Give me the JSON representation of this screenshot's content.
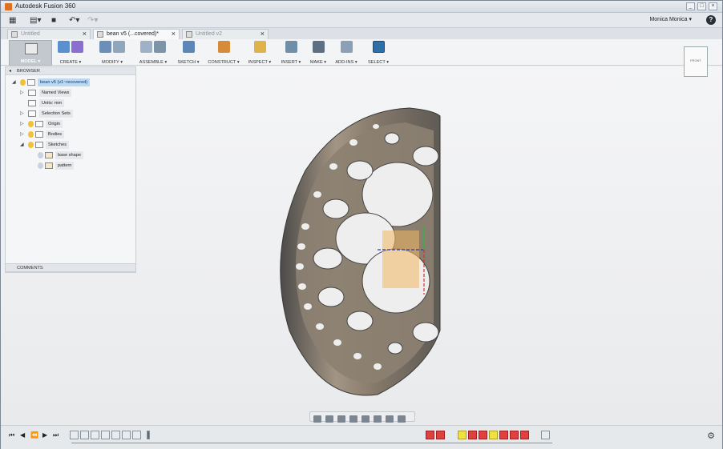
{
  "window": {
    "title": "Autodesk Fusion 360",
    "buttons": [
      "_",
      "□",
      "×"
    ]
  },
  "qat": {
    "grid_icon": "grid-icon",
    "file_icon": "file-icon",
    "save_icon": "save-icon",
    "undo_icon": "undo-icon",
    "redo_icon": "redo-icon",
    "user": "Monica Monica ▾",
    "help": "?"
  },
  "tabs": [
    {
      "label": "Untitled",
      "active": false
    },
    {
      "label": "bean v5 (...covered)*",
      "active": true
    },
    {
      "label": "Untitled v2",
      "active": false
    }
  ],
  "tab_plus": "+",
  "ribbon": {
    "model": "MODEL ▾",
    "groups": [
      {
        "label": "CREATE ▾"
      },
      {
        "label": "MODIFY ▾"
      },
      {
        "label": "ASSEMBLE ▾"
      },
      {
        "label": "SKETCH ▾"
      },
      {
        "label": "CONSTRUCT ▾"
      },
      {
        "label": "INSPECT ▾"
      },
      {
        "label": "INSERT ▾"
      },
      {
        "label": "MAKE ▾"
      },
      {
        "label": "ADD-INS ▾"
      },
      {
        "label": "SELECT ▾"
      }
    ]
  },
  "browser": {
    "header": "BROWSER",
    "nodes": [
      {
        "label": "bean v5 (v1~recovered)",
        "selected": true
      },
      {
        "label": "Named Views"
      },
      {
        "label": "Units: mm"
      },
      {
        "label": "Selection Sets"
      },
      {
        "label": "Origin"
      },
      {
        "label": "Bodies"
      },
      {
        "label": "Sketches"
      },
      {
        "label": "base shape"
      },
      {
        "label": "pattern"
      }
    ],
    "comments": "COMMENTS"
  },
  "viewcube": {
    "label": "FRONT"
  },
  "timeline": {
    "playback": [
      "⏮",
      "◀",
      "⏪",
      "▶",
      "⏭"
    ],
    "settings_icon": "gear-icon"
  },
  "colors": {
    "accent": "#2e6fa7",
    "body": "#8b7e6f",
    "highlight": "#f2b660"
  }
}
